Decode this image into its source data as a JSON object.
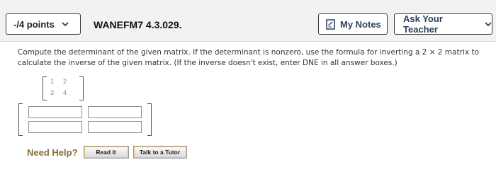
{
  "header": {
    "points_label": "-/4 points",
    "assignment_id": "WANEFM7 4.3.029.",
    "my_notes_label": "My Notes",
    "ask_teacher_label": "Ask Your Teacher"
  },
  "question": {
    "text": "Compute the determinant of the given matrix. If the determinant is nonzero, use the formula for inverting a 2 × 2 matrix to calculate the inverse of the given matrix. (If the inverse doesn't exist, enter DNE in all answer boxes.)"
  },
  "matrix": {
    "r1c1": "1",
    "r1c2": "2",
    "r2c1": "3",
    "r2c2": "4"
  },
  "help": {
    "need_help": "Need Help?",
    "read_it": "Read It",
    "talk_to_tutor": "Talk to a Tutor"
  },
  "icons": {
    "points_dropdown": "chevron-down-icon",
    "notes": "note-icon",
    "teacher_dropdown": "chevron-down-icon"
  },
  "colors": {
    "topbar_bg": "#f2f2f2",
    "need_help": "#8a6d3b",
    "notes_text": "#2c3f60"
  }
}
